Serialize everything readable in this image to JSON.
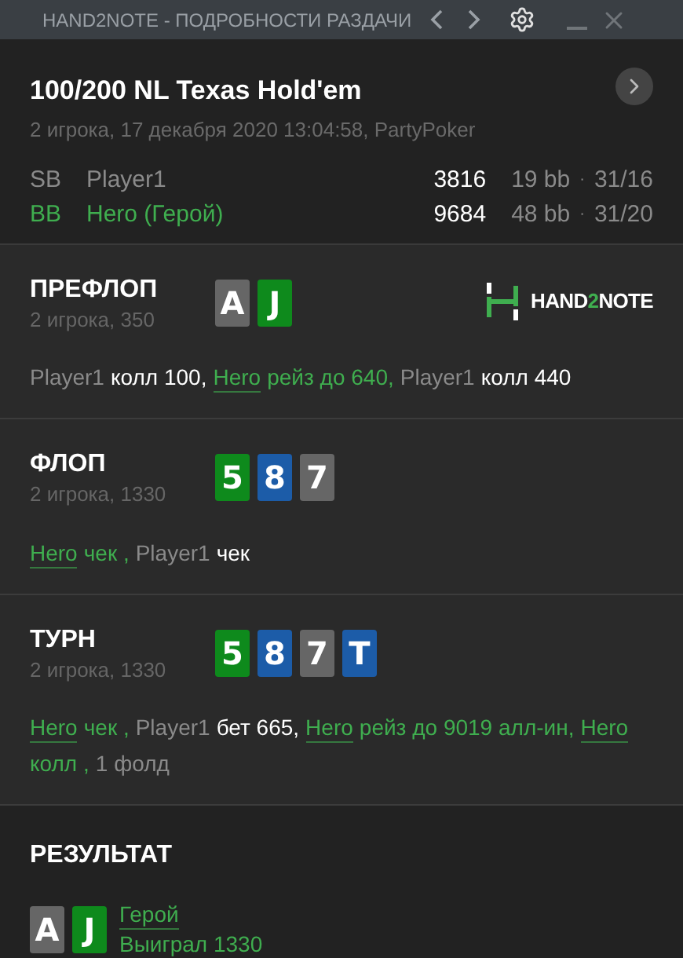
{
  "window": {
    "title": "HAND2NOTE - ПОДРОБНОСТИ РАЗДАЧИ"
  },
  "header": {
    "game": "100/200 NL Texas Hold'em",
    "info": "2 игрока, 17 декабря 2020 13:04:58, PartyPoker",
    "players": [
      {
        "position": "SB",
        "name": "Player1",
        "hero": false,
        "stack": "3816",
        "bb": "19 bb",
        "sep": "·",
        "stat": "31/16"
      },
      {
        "position": "BB",
        "name": "Hero (Герой)",
        "hero": true,
        "stack": "9684",
        "bb": "48 bb",
        "sep": "·",
        "stat": "31/20"
      }
    ]
  },
  "logo": {
    "parts": [
      "HAND",
      "2",
      "NOTE"
    ]
  },
  "streets": [
    {
      "name": "ПРЕФЛОП",
      "info": "2 игрока, 350",
      "logo": true,
      "cards": [
        {
          "rank": "A",
          "color": "#666666"
        },
        {
          "rank": "J",
          "color": "#0e8a1c"
        }
      ],
      "actions": [
        {
          "kind": "villain",
          "player": "Player1",
          "text": "колл 100,"
        },
        {
          "kind": "hero",
          "player": "Hero",
          "text": "рейз до 640,"
        },
        {
          "kind": "villain",
          "player": "Player1",
          "text": "колл 440"
        }
      ]
    },
    {
      "name": "ФЛОП",
      "info": "2 игрока, 1330",
      "logo": false,
      "cards": [
        {
          "rank": "5",
          "color": "#0e8a1c"
        },
        {
          "rank": "8",
          "color": "#1c5ca8"
        },
        {
          "rank": "7",
          "color": "#666666"
        }
      ],
      "actions": [
        {
          "kind": "hero",
          "player": "Hero",
          "text": "чек ,"
        },
        {
          "kind": "villain",
          "player": "Player1",
          "text": "чек"
        }
      ]
    },
    {
      "name": "ТУРН",
      "info": "2 игрока, 1330",
      "logo": false,
      "cards": [
        {
          "rank": "5",
          "color": "#0e8a1c"
        },
        {
          "rank": "8",
          "color": "#1c5ca8"
        },
        {
          "rank": "7",
          "color": "#666666"
        },
        {
          "rank": "T",
          "color": "#1c5ca8"
        }
      ],
      "actions": [
        {
          "kind": "hero",
          "player": "Hero",
          "text": "чек ,"
        },
        {
          "kind": "villain",
          "player": "Player1",
          "text": "бет 665,"
        },
        {
          "kind": "hero",
          "player": "Hero",
          "text": "рейз до 9019 алл-ин,"
        },
        {
          "kind": "hero",
          "player": "Hero",
          "text": "колл ,"
        },
        {
          "kind": "summary",
          "text": "1 фолд"
        }
      ]
    }
  ],
  "result": {
    "title": "РЕЗУЛЬТАТ",
    "cards": [
      {
        "rank": "A",
        "color": "#666666"
      },
      {
        "rank": "J",
        "color": "#0e8a1c"
      }
    ],
    "winner": "Герой",
    "outcome": "Выиграл 1330"
  }
}
